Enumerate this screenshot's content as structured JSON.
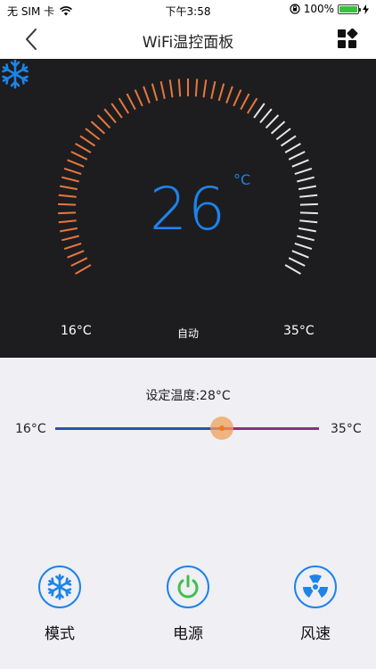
{
  "status": {
    "carrier": "无 SIM 卡",
    "time": "下午3:58",
    "battery_text": "100%"
  },
  "nav": {
    "title": "WiFi温控面板"
  },
  "dial": {
    "temperature": "26",
    "unit": "°C",
    "min_label": "16°C",
    "max_label": "35°C",
    "mode_label": "自动",
    "min_value": 16,
    "max_value": 35,
    "active_value": 28,
    "active_color": "#e8773f",
    "inactive_color": "#e6e6e6",
    "accent_color": "#1d84ea"
  },
  "slider": {
    "set_label": "设定温度:28°C",
    "min_label": "16°C",
    "max_label": "35°C",
    "value": 28,
    "min": 16,
    "max": 35,
    "low_color": "#2f52a3",
    "high_color": "#8b2d8a",
    "thumb_color": "#f07a1c"
  },
  "controls": [
    {
      "label": "模式",
      "icon": "snowflake-icon"
    },
    {
      "label": "电源",
      "icon": "power-icon"
    },
    {
      "label": "风速",
      "icon": "fan-icon"
    }
  ]
}
